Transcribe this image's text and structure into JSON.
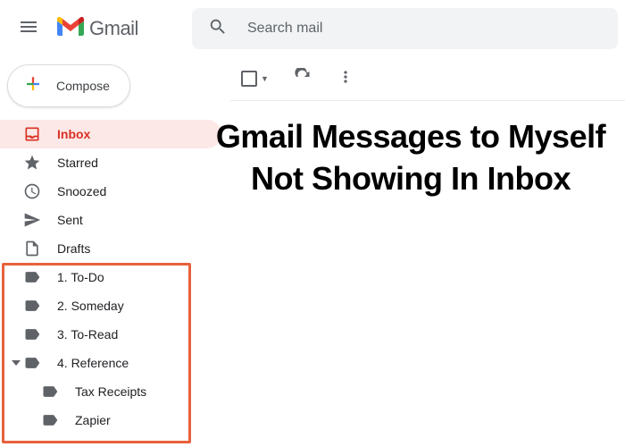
{
  "header": {
    "brand": "Gmail",
    "search_placeholder": "Search mail"
  },
  "compose": {
    "label": "Compose"
  },
  "sidebar": {
    "items": [
      {
        "label": "Inbox"
      },
      {
        "label": "Starred"
      },
      {
        "label": "Snoozed"
      },
      {
        "label": "Sent"
      },
      {
        "label": "Drafts"
      },
      {
        "label": "1. To-Do"
      },
      {
        "label": "2. Someday"
      },
      {
        "label": "3. To-Read"
      },
      {
        "label": "4. Reference"
      },
      {
        "label": "Tax Receipts"
      },
      {
        "label": "Zapier"
      }
    ]
  },
  "overlay": {
    "text": "Gmail Messages to Myself Not Showing In Inbox"
  }
}
